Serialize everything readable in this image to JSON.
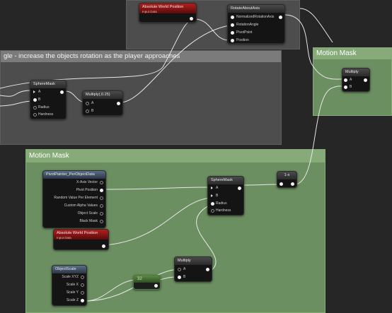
{
  "comments": {
    "top_grey_title": "",
    "left_grey_title": "gle - increase the objects rotation as the player approaches",
    "motion_mask_top_title": "Motion Mask",
    "motion_mask_bottom_title": "Motion Mask"
  },
  "nodes": {
    "abs_world_pos_top": {
      "title": "Absolute World Position",
      "subtitle": "Input Data"
    },
    "rotate_about_axis": {
      "title": "RotateAboutAxis",
      "pins": [
        "NormalizedRotationAxis",
        "RotationAngle",
        "PivotPoint",
        "Position"
      ]
    },
    "multiply_top_right": {
      "title": "Multiply",
      "pins": [
        "A",
        "B"
      ]
    },
    "sphere_mask_top": {
      "title": "SphereMask",
      "pins": [
        "A",
        "B",
        "Radius",
        "Hardness"
      ]
    },
    "multiply_025": {
      "title": "Multiply(,0.25)",
      "pins": [
        "A",
        "B"
      ]
    },
    "pivot_painter": {
      "title": "PivotPainter_PerObjectData",
      "pins": [
        "X-Axis Vector",
        "Pivot Position",
        "Random Value Per Element",
        "Custom Alpha Values",
        "Object Scale",
        "Black Mask"
      ]
    },
    "sphere_mask_bottom": {
      "title": "SphereMask",
      "pins": [
        "A",
        "B",
        "Radius",
        "Hardness"
      ]
    },
    "one_minus": {
      "title": "1-x"
    },
    "abs_world_pos_bottom": {
      "title": "Absolute World Position",
      "subtitle": "Input Data"
    },
    "multiply_bottom": {
      "title": "Multiply",
      "pins": [
        "A",
        "B"
      ]
    },
    "object_scale": {
      "title": "ObjectScale",
      "pins": [
        "Scale XYZ",
        "Scale X",
        "Scale Y",
        "Scale Z"
      ]
    },
    "const_32": {
      "title": "32"
    }
  }
}
